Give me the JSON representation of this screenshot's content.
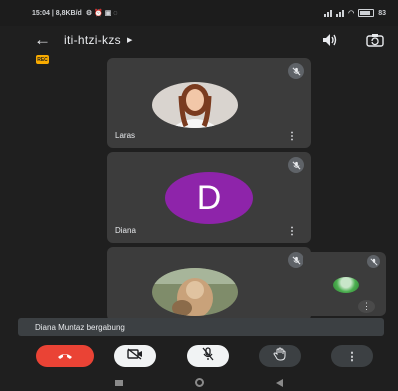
{
  "status_bar": {
    "time_info": "15:04 | 8,8KB/d",
    "battery": "83"
  },
  "header": {
    "meeting_code": "iti-htzi-kzs",
    "caret_icon": "caret-right-icon",
    "speaker_icon": "speaker-icon",
    "switch_camera_icon": "switch-camera-icon"
  },
  "badge": {
    "label": "REC"
  },
  "participants": [
    {
      "name": "Laras",
      "avatar": "photo",
      "muted": true
    },
    {
      "name": "Diana",
      "avatar": "letter",
      "initial": "D",
      "avatar_color": "#8e24aa",
      "muted": true
    },
    {
      "name": "",
      "avatar": "photo",
      "muted": true
    }
  ],
  "self_view": {
    "muted": true
  },
  "toast": {
    "message": "Diana Muntaz bergabung"
  },
  "controls": {
    "end_call_color": "#ea4335",
    "more_label": "⋮"
  },
  "colors": {
    "background": "#1f1f1f",
    "tile": "#3c3c3c",
    "accent_red": "#ea4335",
    "badge": "#f9ab00"
  }
}
